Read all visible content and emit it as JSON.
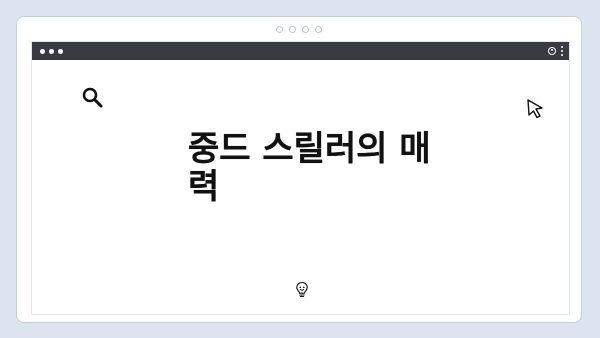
{
  "post": {
    "title": "중드 스릴러의 매력"
  },
  "icons": {
    "search": "search-icon",
    "cursor": "cursor-icon",
    "profile": "profile-icon",
    "more": "more-vertical-icon",
    "bulb": "lightbulb-icon"
  },
  "colors": {
    "background": "#dce4ef",
    "card": "#ffffff",
    "browser_bar": "#383b41",
    "title": "#111111"
  }
}
